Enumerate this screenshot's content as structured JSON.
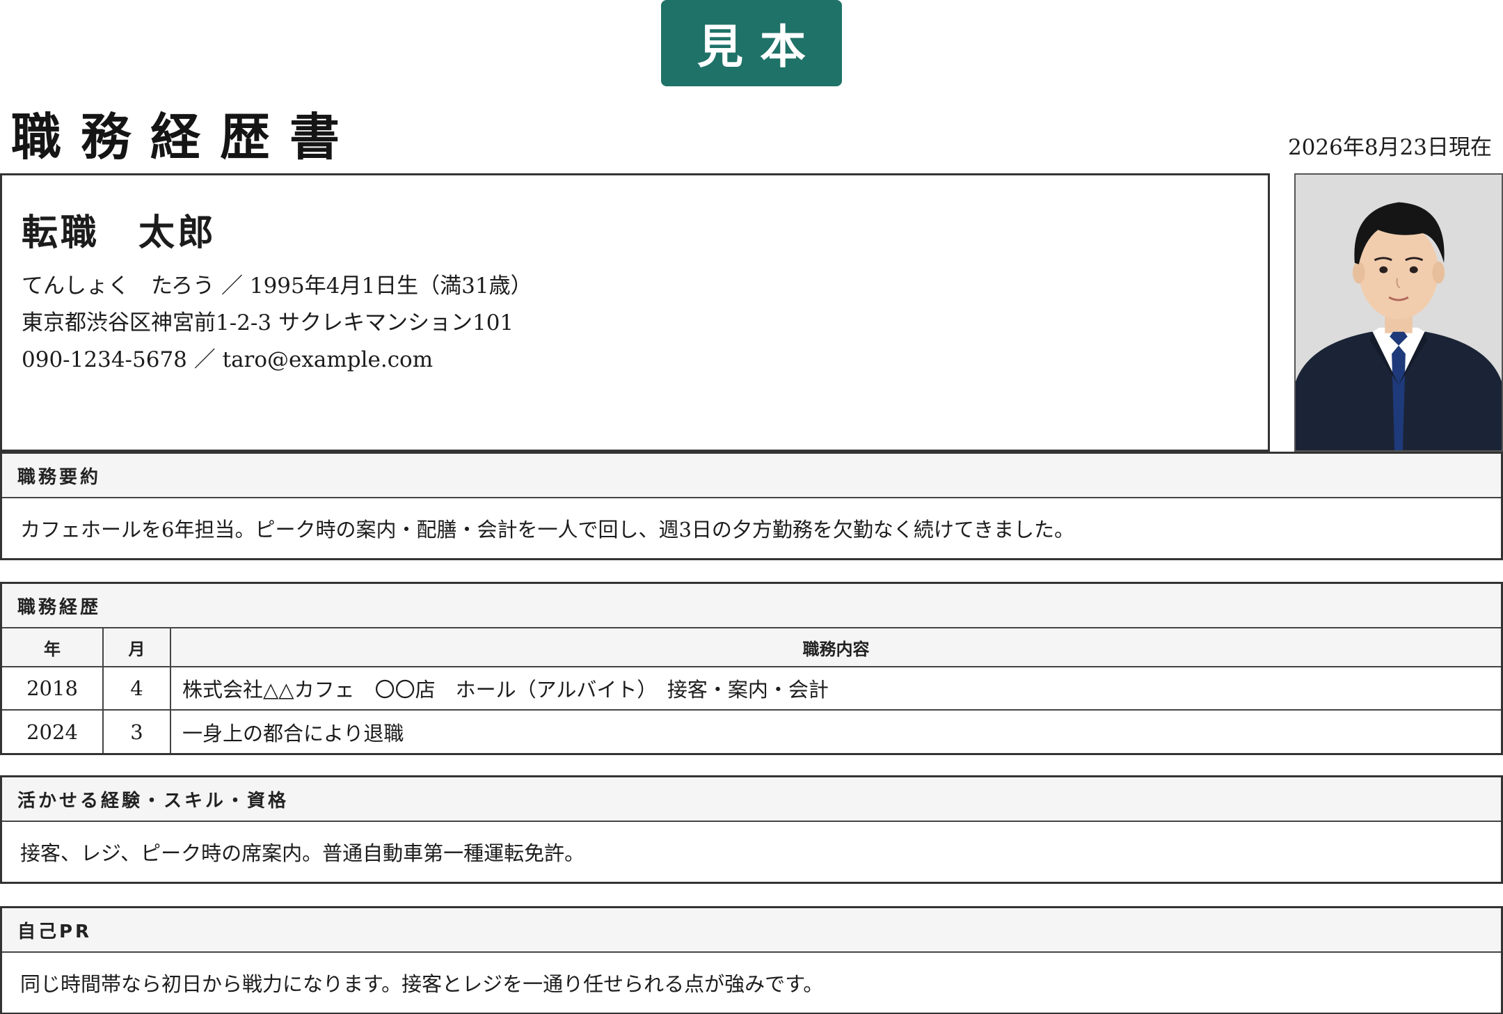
{
  "badge": "見本",
  "title": "職務経歴書",
  "date": "2026年8月23日現在",
  "profile": {
    "name": "転職　太郎",
    "kana_birth": "てんしょく　たろう ／ 1995年4月1日生（満31歳）",
    "address": "東京都渋谷区神宮前1-2-3 サクレキマンション101",
    "contact": "090-1234-5678 ／ taro@example.com",
    "photo": "portrait-photo"
  },
  "summary": {
    "label": "職務要約",
    "text": "カフェホールを6年担当。ピーク時の案内・配膳・会計を一人で回し、週3日の夕方勤務を欠勤なく続けてきました。"
  },
  "history": {
    "label": "職務経歴",
    "headers": {
      "year": "年",
      "month": "月",
      "content": "職務内容"
    },
    "rows": [
      {
        "year": "2018",
        "month": "4",
        "content": "株式会社△△カフェ　〇〇店　ホール（アルバイト）　接客・案内・会計"
      },
      {
        "year": "2024",
        "month": "3",
        "content": "一身上の都合により退職"
      }
    ]
  },
  "skills": {
    "label": "活かせる経験・スキル・資格",
    "text": "接客、レジ、ピーク時の席案内。普通自動車第一種運転免許。"
  },
  "pr": {
    "label": "自己PR",
    "text": "同じ時間帯なら初日から戦力になります。接客とレジを一通り任せられる点が強みです。"
  },
  "colors": {
    "badge": "#1f7268",
    "border": "#333333",
    "header_bg": "#f5f5f5"
  }
}
